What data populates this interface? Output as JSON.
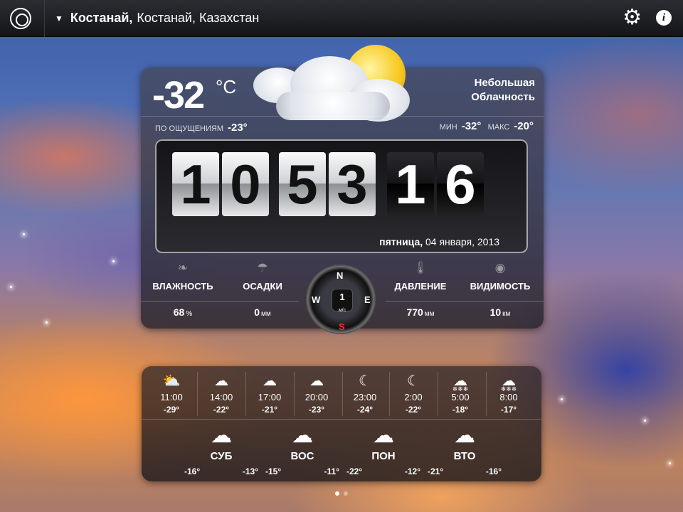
{
  "topbar": {
    "city": "Костанай,",
    "region": "Костанай, Казахстан"
  },
  "current": {
    "temp": "-32",
    "unit": "°C",
    "condition_line1": "Небольшая",
    "condition_line2": "Облачность",
    "feels_label": "ПО ОЩУЩЕНИЯМ",
    "feels_value": "-23°",
    "min_label": "МИН",
    "min_value": "-32°",
    "max_label": "МАКС",
    "max_value": "-20°"
  },
  "clock": {
    "digits": [
      "1",
      "0",
      "5",
      "3",
      "1",
      "6"
    ],
    "weekday": "пятница,",
    "date": "04 января, 2013"
  },
  "stats": [
    {
      "label": "ВЛАЖНОСТЬ",
      "value": "68",
      "unit": "%",
      "icon": "humidity-icon"
    },
    {
      "label": "ОСАДКИ",
      "value": "0",
      "unit": "мм",
      "icon": "umbrella-icon"
    },
    {
      "label": "ДАВЛЕНИЕ",
      "value": "770",
      "unit": "мм",
      "icon": "thermometer-icon"
    },
    {
      "label": "ВИДИМОСТЬ",
      "value": "10",
      "unit": "км",
      "icon": "eye-icon"
    }
  ],
  "wind": {
    "speed": "1",
    "unit": "м/с",
    "n": "N",
    "e": "E",
    "w": "W",
    "s": "S"
  },
  "hourly": [
    {
      "time": "11:00",
      "temp": "-29°",
      "icon": "sun-cloud-icon"
    },
    {
      "time": "14:00",
      "temp": "-22°",
      "icon": "cloud-icon"
    },
    {
      "time": "17:00",
      "temp": "-21°",
      "icon": "cloud-icon"
    },
    {
      "time": "20:00",
      "temp": "-23°",
      "icon": "cloud-icon"
    },
    {
      "time": "23:00",
      "temp": "-24°",
      "icon": "moon-icon"
    },
    {
      "time": "2:00",
      "temp": "-22°",
      "icon": "moon-icon"
    },
    {
      "time": "5:00",
      "temp": "-18°",
      "icon": "snow-cloud-icon"
    },
    {
      "time": "8:00",
      "temp": "-17°",
      "icon": "snow-cloud-icon"
    }
  ],
  "daily": [
    {
      "name": "СУБ",
      "low": "-16°",
      "high": "-13°",
      "icon": "snow-cloud-icon"
    },
    {
      "name": "ВОС",
      "low": "-15°",
      "high": "-11°",
      "icon": "cloud-icon"
    },
    {
      "name": "ПОН",
      "low": "-22°",
      "high": "-12°",
      "icon": "snow-cloud-icon"
    },
    {
      "name": "ВТО",
      "low": "-21°",
      "high": "-16°",
      "icon": "cloud-icon"
    }
  ]
}
